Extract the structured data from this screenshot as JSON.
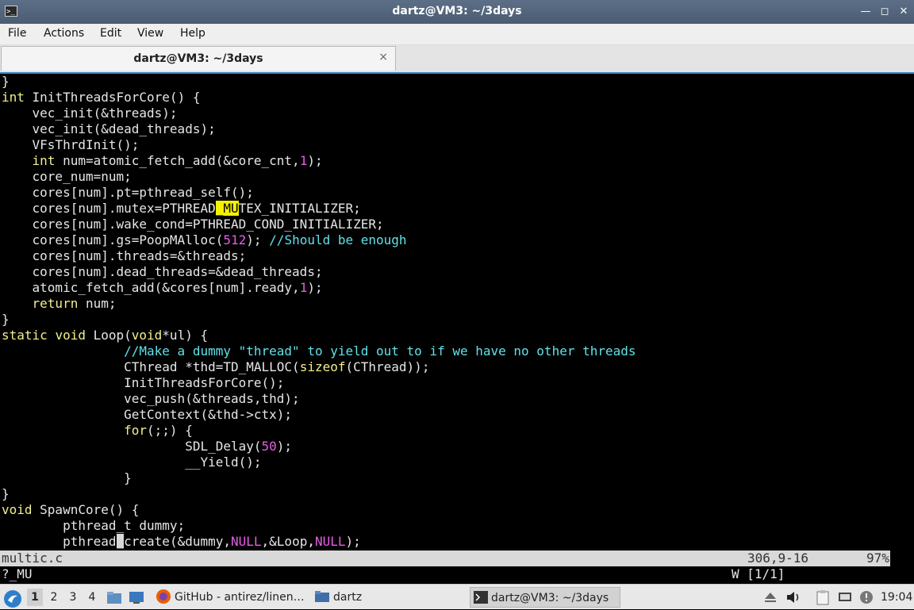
{
  "window": {
    "title": "dartz@VM3: ~/3days"
  },
  "menu": [
    "File",
    "Actions",
    "Edit",
    "View",
    "Help"
  ],
  "tab": {
    "label": "dartz@VM3: ~/3days",
    "close": "×"
  },
  "code_lines": [
    [
      {
        "t": "}"
      }
    ],
    [
      {
        "t": "int",
        "c": "kw"
      },
      {
        "t": " InitThreadsForCore() {"
      }
    ],
    [
      {
        "t": "    vec_init(&threads);"
      }
    ],
    [
      {
        "t": "    vec_init(&dead_threads);"
      }
    ],
    [
      {
        "t": "    VFsThrdInit();"
      }
    ],
    [
      {
        "t": "    "
      },
      {
        "t": "int",
        "c": "kw"
      },
      {
        "t": " num=atomic_fetch_add(&core_cnt,"
      },
      {
        "t": "1",
        "c": "num"
      },
      {
        "t": ");"
      }
    ],
    [
      {
        "t": "    core_num=num;"
      }
    ],
    [
      {
        "t": "    cores[num].pt=pthread_self();"
      }
    ],
    [
      {
        "t": "    cores[num].mutex=PTHREAD"
      },
      {
        "t": "_MU",
        "c": "hl"
      },
      {
        "t": "TEX_INITIALIZER;"
      }
    ],
    [
      {
        "t": "    cores[num].wake_cond=PTHREAD_COND_INITIALIZER;"
      }
    ],
    [
      {
        "t": "    cores[num].gs=PoopMAlloc("
      },
      {
        "t": "512",
        "c": "num"
      },
      {
        "t": "); "
      },
      {
        "t": "//Should be enough",
        "c": "cm"
      }
    ],
    [
      {
        "t": "    cores[num].threads=&threads;"
      }
    ],
    [
      {
        "t": "    cores[num].dead_threads=&dead_threads;"
      }
    ],
    [
      {
        "t": "    atomic_fetch_add(&cores[num].ready,"
      },
      {
        "t": "1",
        "c": "num"
      },
      {
        "t": ");"
      }
    ],
    [
      {
        "t": "    "
      },
      {
        "t": "return",
        "c": "kw"
      },
      {
        "t": " num;"
      }
    ],
    [
      {
        "t": "}"
      }
    ],
    [
      {
        "t": "static",
        "c": "kw"
      },
      {
        "t": " "
      },
      {
        "t": "void",
        "c": "kw"
      },
      {
        "t": " Loop("
      },
      {
        "t": "void",
        "c": "kw"
      },
      {
        "t": "*ul) {"
      }
    ],
    [
      {
        "t": "                "
      },
      {
        "t": "//Make a dummy \"thread\" to yield out to if we have no other threads",
        "c": "cm"
      }
    ],
    [
      {
        "t": "                CThread *thd=TD_MALLOC("
      },
      {
        "t": "sizeof",
        "c": "kw"
      },
      {
        "t": "(CThread));"
      }
    ],
    [
      {
        "t": "                InitThreadsForCore();"
      }
    ],
    [
      {
        "t": "                vec_push(&threads,thd);"
      }
    ],
    [
      {
        "t": "                GetContext(&thd->ctx);"
      }
    ],
    [
      {
        "t": "                "
      },
      {
        "t": "for",
        "c": "kw"
      },
      {
        "t": "(;;) {"
      }
    ],
    [
      {
        "t": "                        SDL_Delay("
      },
      {
        "t": "50",
        "c": "num"
      },
      {
        "t": ");"
      }
    ],
    [
      {
        "t": "                        __Yield();"
      }
    ],
    [
      {
        "t": "                }"
      }
    ],
    [
      {
        "t": "}"
      }
    ],
    [
      {
        "t": "void",
        "c": "kw"
      },
      {
        "t": " SpawnCore() {"
      }
    ],
    [
      {
        "t": "        pthread_t dummy;"
      }
    ],
    [
      {
        "t": "        pthread"
      },
      {
        "t": "_",
        "c": "cursor"
      },
      {
        "t": "create(&dummy,"
      },
      {
        "t": "NULL",
        "c": "num"
      },
      {
        "t": ",&Loop,"
      },
      {
        "t": "NULL",
        "c": "num"
      },
      {
        "t": ");"
      }
    ]
  ],
  "status": {
    "filename": "multic.c",
    "position": "306,9-16",
    "percent": "97%"
  },
  "cmdline": {
    "command": "?_MU",
    "search_status": "W [1/1]"
  },
  "taskbar": {
    "workspaces": [
      "1",
      "2",
      "3",
      "4"
    ],
    "tasks": [
      {
        "label": "GitHub - antirez/linen…",
        "icon": "firefox-icon"
      },
      {
        "label": "dartz",
        "icon": "folder-icon"
      },
      {
        "label": "dartz@VM3: ~/3days",
        "icon": "terminal-icon"
      }
    ],
    "clock": "19:04"
  },
  "colors": {
    "titlebar": "#4f6279",
    "keyword": "#f2f08c",
    "number": "#e85be8",
    "comment": "#60e0e8",
    "search_highlight": "#f5f200",
    "accent": "#3b83c5"
  }
}
